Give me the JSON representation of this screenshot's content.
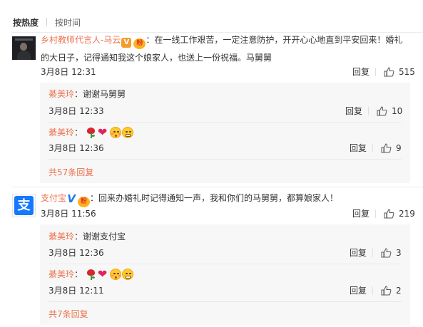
{
  "sort": {
    "hot": "按热度",
    "time": "按时间"
  },
  "comments": [
    {
      "user": "乡村教师代言人-马云",
      "badge": "V",
      "fan_badge": "粉",
      "text": "：在一线工作艰苦，一定注意防护，开开心心地直到平安回来！婚礼的大日子，记得通知我这个娘家人，也送上一份祝福。马舅舅",
      "time": "3月8日 12:31",
      "reply": "回复",
      "likes": "515",
      "replies": [
        {
          "user": "綦美玲",
          "text": "：谢谢马舅舅",
          "time": "3月8日 12:33",
          "reply": "回复",
          "likes": "10"
        },
        {
          "user": "綦美玲",
          "text": "：",
          "emoji": [
            "rose",
            "heart",
            "kiss-face",
            "grin-face"
          ],
          "time": "3月8日 12:36",
          "reply": "回复",
          "likes": "9"
        }
      ],
      "more": "共57条回复"
    },
    {
      "user": "支付宝",
      "badge": "V",
      "fan_badge": "粉",
      "text": "：回来办婚礼时记得通知一声，我和你们的马舅舅，都算娘家人！",
      "time": "3月8日 11:56",
      "reply": "回复",
      "likes": "219",
      "replies": [
        {
          "user": "綦美玲",
          "text": "：谢谢支付宝",
          "time": "3月8日 12:36",
          "reply": "回复",
          "likes": "3"
        },
        {
          "user": "綦美玲",
          "text": "：",
          "emoji": [
            "rose",
            "heart",
            "kiss-face",
            "grin-face"
          ],
          "time": "3月8日 12:11",
          "reply": "回复",
          "likes": "2"
        }
      ],
      "more": "共7条回复"
    }
  ],
  "icons": {
    "like": "thumbs-up-icon",
    "alipay": "alipay-logo-icon"
  },
  "colors": {
    "username": "#eb7350",
    "sub_bg": "#f7f7f7",
    "alipay": "#1677ff"
  }
}
